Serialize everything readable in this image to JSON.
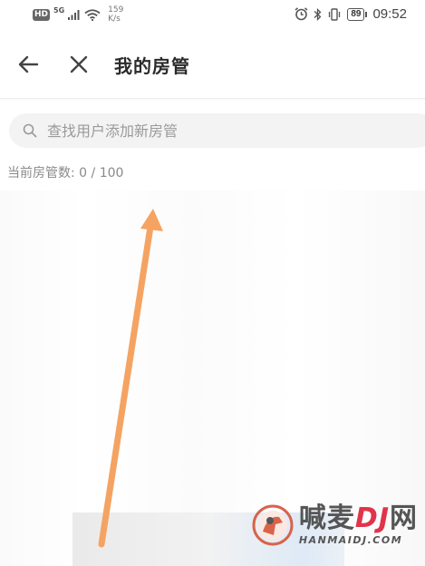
{
  "status_bar": {
    "hd_badge": "HD",
    "network_type": "5G",
    "speed_value": "159",
    "speed_unit": "K/s",
    "battery_level": "89",
    "time": "09:52"
  },
  "nav": {
    "title": "我的房管"
  },
  "search": {
    "placeholder": "查找用户添加新房管"
  },
  "moderators": {
    "count_text": "当前房管数: 0 / 100"
  },
  "watermark": {
    "cn_part1": "喊麦",
    "cn_accent": "DJ",
    "cn_part2": "网",
    "en": "HANMAIDJ.COM"
  },
  "colors": {
    "annotation_arrow": "#f5a362",
    "watermark_red": "#e0344b",
    "search_bg": "#f3f3f3"
  }
}
